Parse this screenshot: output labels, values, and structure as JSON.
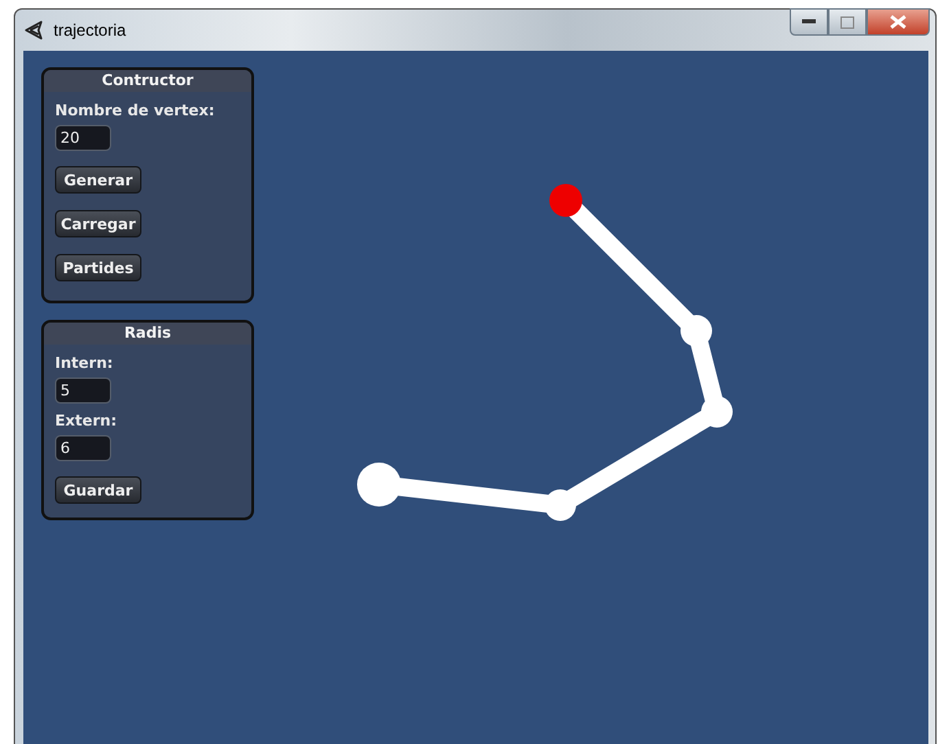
{
  "window": {
    "title": "trajectoria"
  },
  "panels": [
    {
      "title": "Contructor",
      "items": [
        {
          "kind": "label",
          "text": "Nombre de vertex:"
        },
        {
          "kind": "field",
          "value": "20"
        },
        {
          "kind": "button",
          "label": "Generar"
        },
        {
          "kind": "button",
          "label": "Carregar"
        },
        {
          "kind": "button",
          "label": "Partides"
        }
      ]
    },
    {
      "title": "Radis",
      "items": [
        {
          "kind": "label",
          "text": "Intern:"
        },
        {
          "kind": "field",
          "value": "5"
        },
        {
          "kind": "label",
          "text": "Extern:"
        },
        {
          "kind": "field",
          "value": "6"
        },
        {
          "kind": "button",
          "label": "Guardar"
        }
      ]
    }
  ]
}
